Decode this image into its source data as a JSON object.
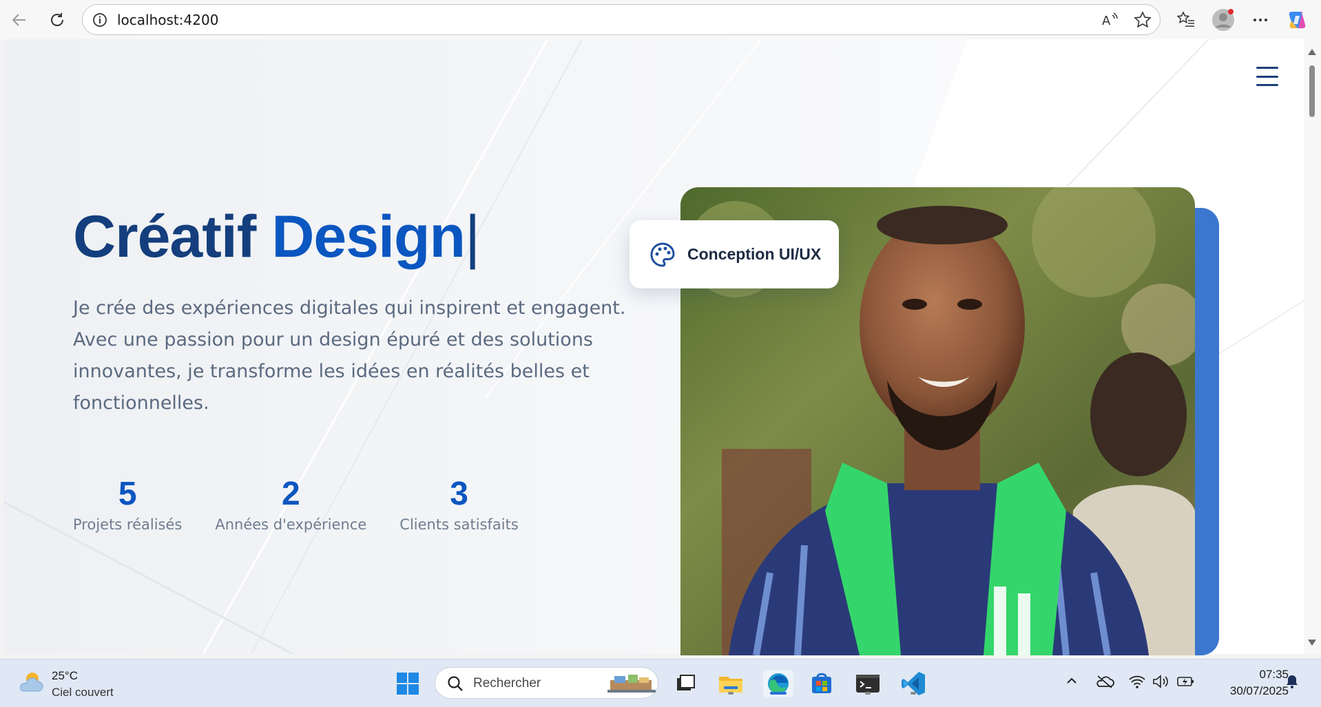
{
  "browser": {
    "url": "localhost:4200"
  },
  "hero": {
    "title_part1": "Créatif",
    "title_part2": "Design",
    "cursor": "|",
    "description": "Je crée des expériences digitales qui inspirent et engagent. Avec une passion pour un design épuré et des solutions innovantes, je transforme les idées en réalités belles et fonctionnelles.",
    "stats": [
      {
        "value": "5",
        "label": "Projets réalisés"
      },
      {
        "value": "2",
        "label": "Années d'expérience"
      },
      {
        "value": "3",
        "label": "Clients satisfaits"
      }
    ],
    "badge_label": "Conception UI/UX"
  },
  "colors": {
    "title_dark": "#143e7d",
    "title_accent": "#0b56c0",
    "photo_back": "#3b77cf"
  },
  "taskbar": {
    "weather_temp": "25°C",
    "weather_desc": "Ciel couvert",
    "search_placeholder": "Rechercher",
    "time": "07:35",
    "date": "30/07/2025"
  }
}
